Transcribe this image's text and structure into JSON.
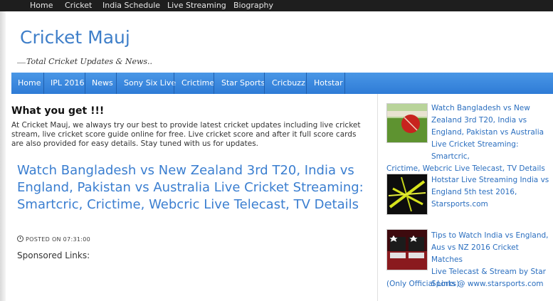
{
  "topnav": {
    "items": [
      "Home",
      "Cricket",
      "India Schedule",
      "Live Streaming",
      "Biography"
    ]
  },
  "header": {
    "site_title": "Cricket Mauj",
    "tagline": "Total Cricket Updates & News.."
  },
  "mainnav": {
    "items": [
      "Home",
      "IPL 2016",
      "News",
      "Sony Six Live",
      "Crictime",
      "Star Sports",
      "Cricbuzz",
      "Hotstar"
    ]
  },
  "content": {
    "heading": "What you get !!!",
    "intro": "At Cricket Mauj, we always try our best to provide latest cricket updates including live cricket stream, live cricket score guide online for free. Live cricket score and after it full score cards are also provided for easy details. Stay tuned with us for updates.",
    "post_title": "Watch Bangladesh vs New Zealand 3rd T20, India vs England, Pakistan vs Australia Live Cricket Streaming: Smartcric, Crictime, Webcric Live Telecast, TV Details",
    "posted_label": "POSTED ON 07:31:00",
    "sponsored": "Sponsored Links:"
  },
  "sidebar": {
    "posts": [
      {
        "lines": [
          "Watch Bangladesh vs New",
          "Zealand 3rd T20, India vs",
          "England, Pakistan vs Australia",
          "Live Cricket Streaming: Smartcric,",
          "Crictime, Webcric Live Telecast, TV Details"
        ],
        "thumb_icon": "cricket-ball-thumbnail"
      },
      {
        "lines": [
          "Hotstar Live Streaming India vs",
          "England 5th test 2016,",
          "Starsports.com"
        ],
        "thumb_icon": "hotstar-thumbnail"
      },
      {
        "lines": [
          "Tips to Watch India vs England,",
          "Aus vs NZ 2016 Cricket Matches",
          "Live Telecast & Stream by Star",
          "Sports @ www.starsports.com",
          "(Only Official Links)"
        ],
        "thumb_icon": "star-sports-hd-thumbnail"
      }
    ]
  },
  "colors": {
    "accent": "#3a7ed0",
    "nav_bg": "#3b8be0",
    "topbar_bg": "#1e1e1e"
  }
}
